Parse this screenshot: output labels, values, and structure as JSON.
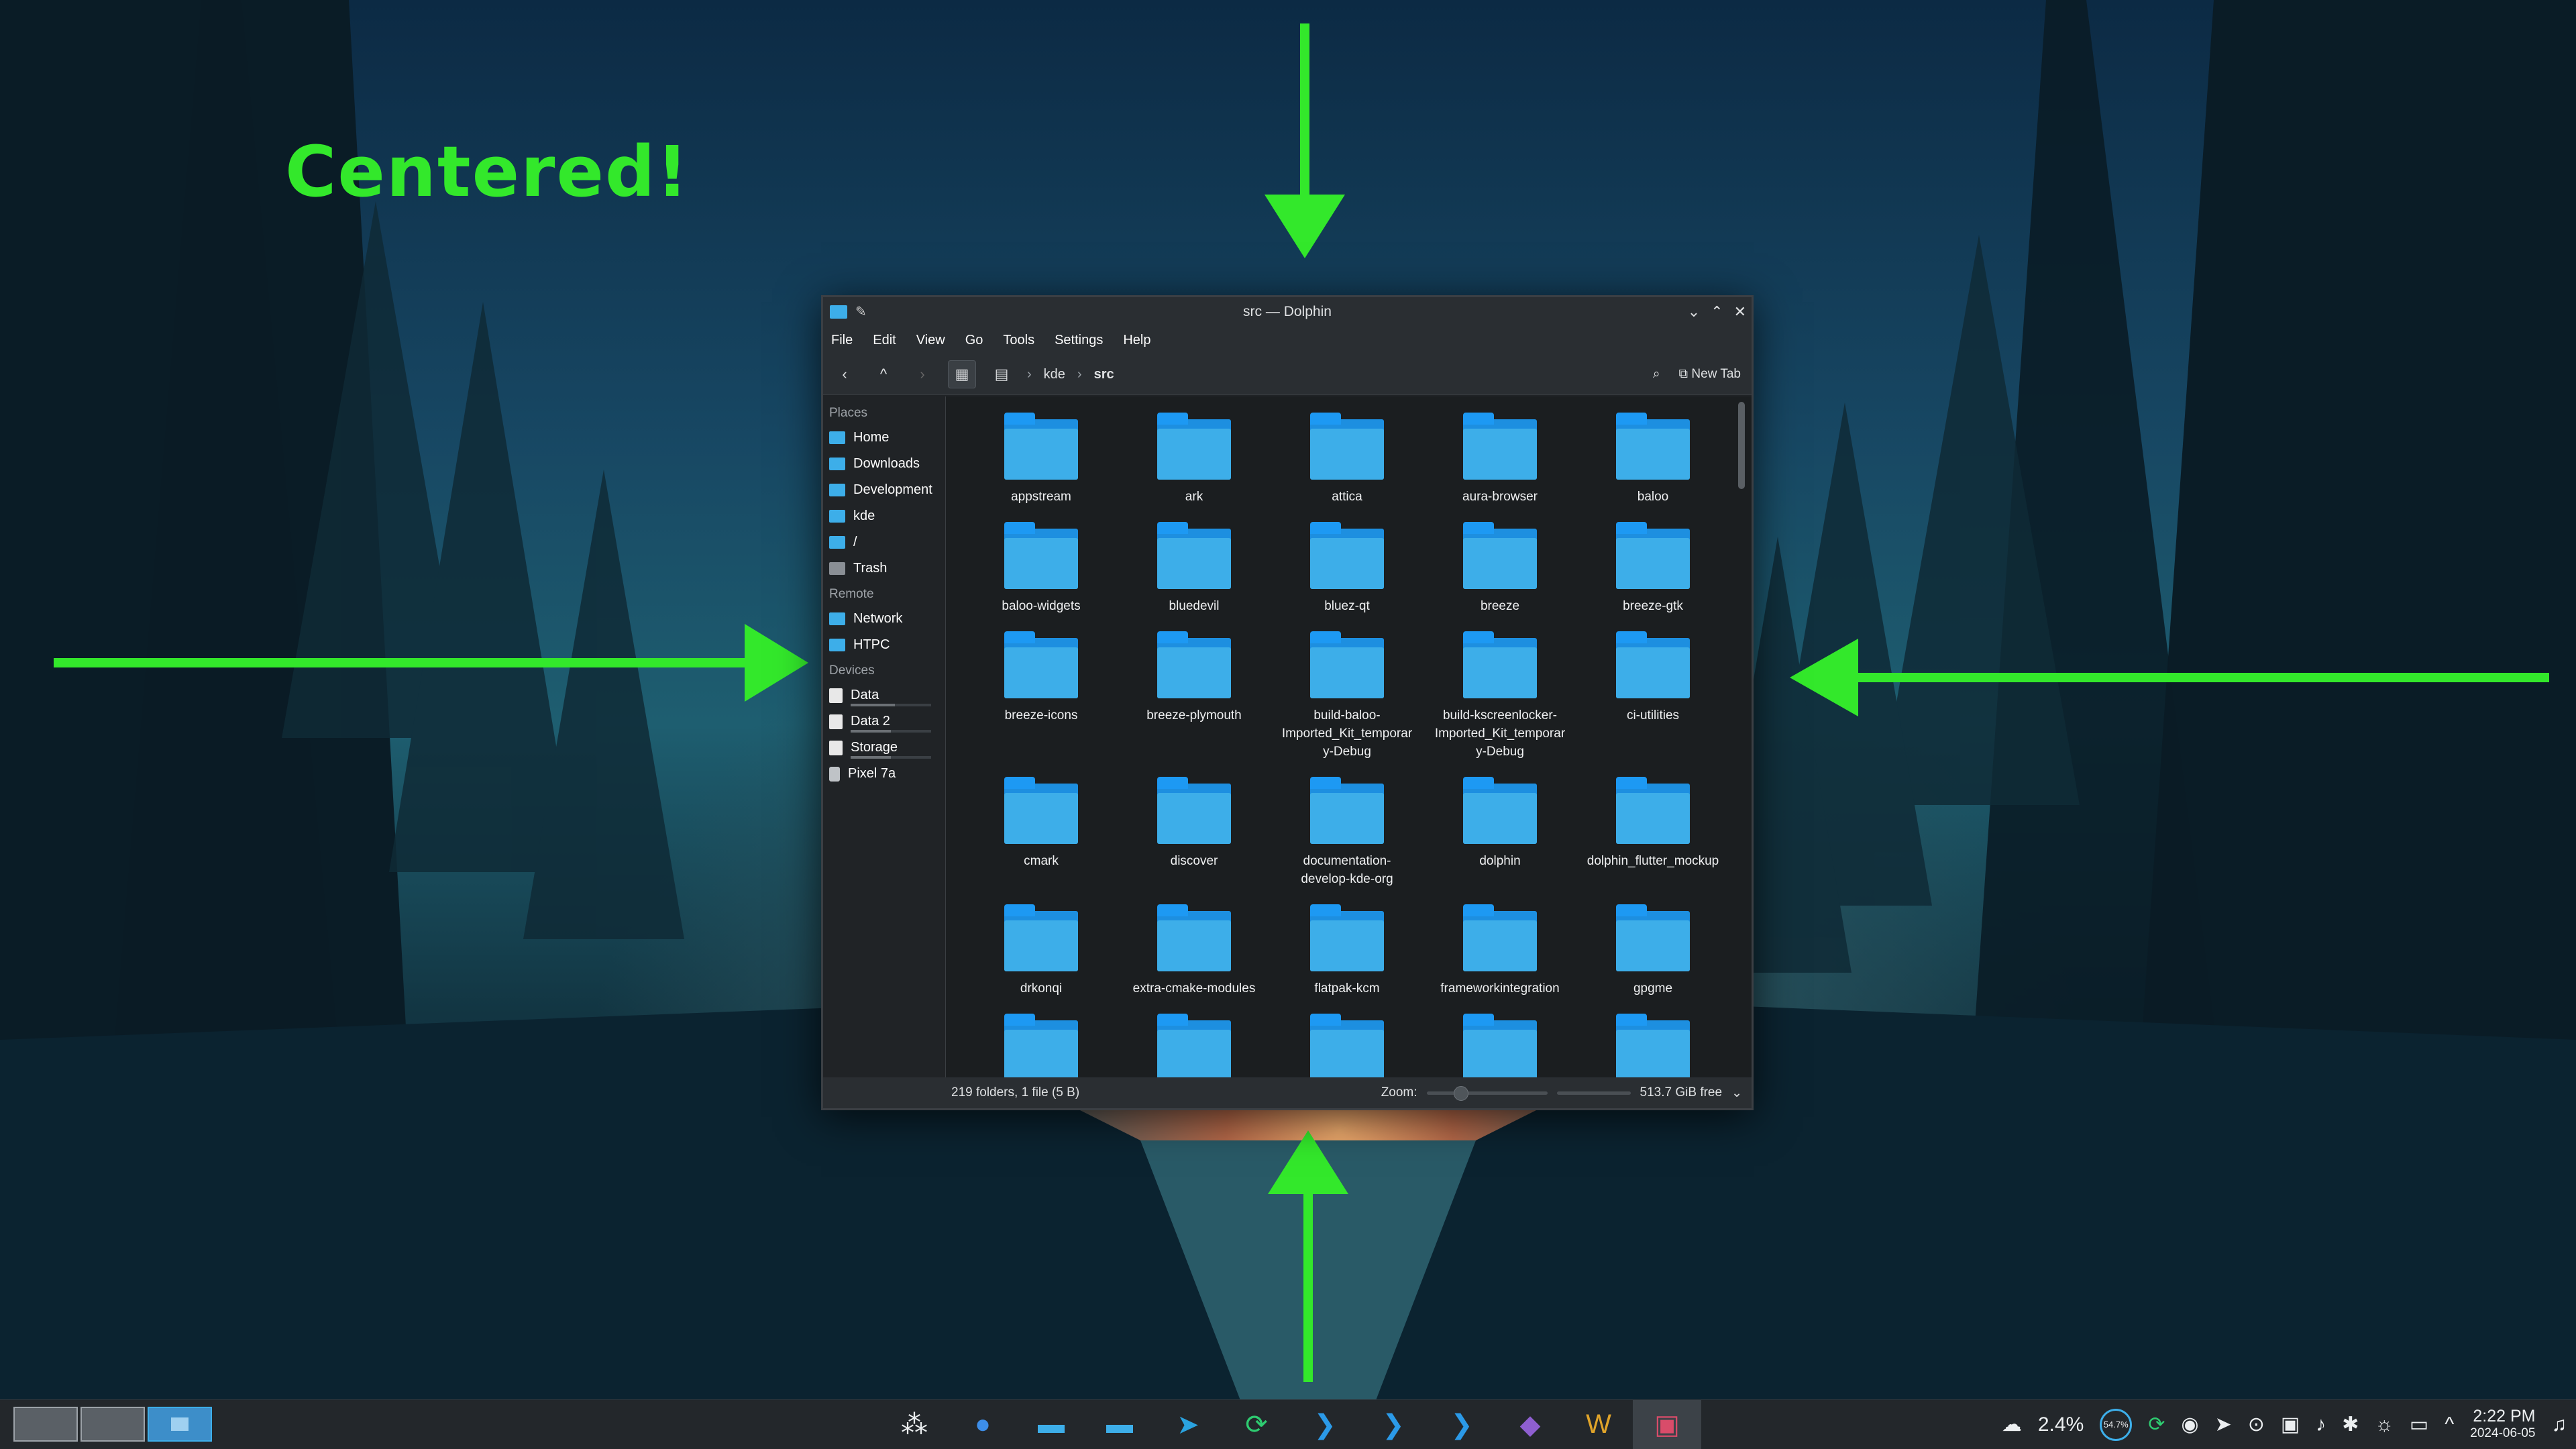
{
  "annotation": {
    "label": "Centered!",
    "color": "#33e82b"
  },
  "window": {
    "title": "src — Dolphin",
    "menu": [
      "File",
      "Edit",
      "View",
      "Go",
      "Tools",
      "Settings",
      "Help"
    ],
    "breadcrumb": [
      "kde",
      "src"
    ],
    "new_tab_label": "New Tab",
    "sidebar": {
      "places_header": "Places",
      "places": [
        "Home",
        "Downloads",
        "Development",
        "kde",
        "/",
        "Trash"
      ],
      "remote_header": "Remote",
      "remote": [
        "Network",
        "HTPC"
      ],
      "devices_header": "Devices",
      "devices": [
        {
          "label": "Data",
          "usage": 0.55
        },
        {
          "label": "Data 2",
          "usage": 0.5
        },
        {
          "label": "Storage",
          "usage": 0.5
        },
        {
          "label": "Pixel 7a"
        }
      ]
    },
    "files": [
      "appstream",
      "ark",
      "attica",
      "aura-browser",
      "baloo",
      "baloo-widgets",
      "bluedevil",
      "bluez-qt",
      "breeze",
      "breeze-gtk",
      "breeze-icons",
      "breeze-plymouth",
      "build-baloo-Imported_Kit_temporary-Debug",
      "build-kscreenlocker-Imported_Kit_temporary-Debug",
      "ci-utilities",
      "cmark",
      "discover",
      "documentation-develop-kde-org",
      "dolphin",
      "dolphin_flutter_mockup",
      "drkonqi",
      "extra-cmake-modules",
      "flatpak-kcm",
      "frameworkintegration",
      "gpgme",
      "",
      "",
      "",
      "",
      ""
    ],
    "status": {
      "summary": "219 folders, 1 file (5 B)",
      "zoom_label": "Zoom:",
      "zoom_level": 0.25,
      "free_space": "513.7 GiB free"
    }
  },
  "taskbar": {
    "apps": [
      "launcher",
      "firefox",
      "dolphin",
      "dolphin",
      "telegram",
      "git-sync",
      "vscode",
      "vscode",
      "vscode",
      "tor-browser",
      "w-app",
      "screenshot"
    ],
    "cpu": "2.4%",
    "mem_gauge": "54.7%",
    "time": "2:22 PM",
    "date": "2024-06-05"
  }
}
